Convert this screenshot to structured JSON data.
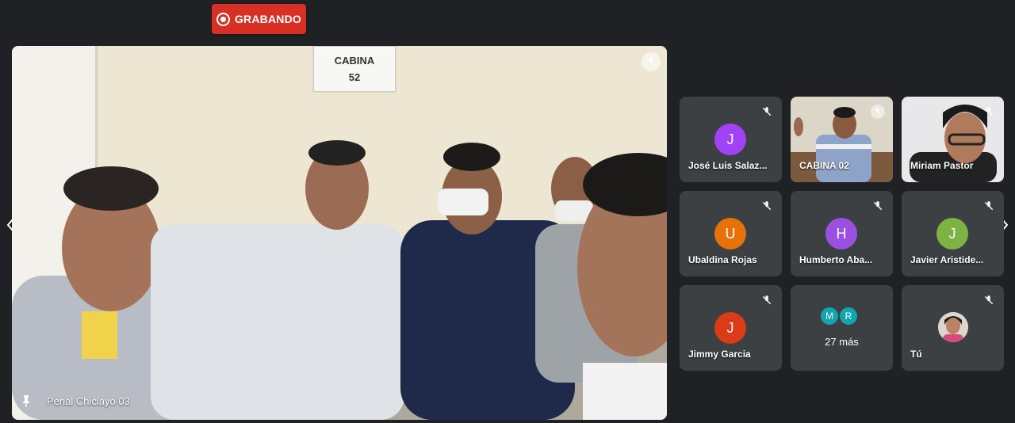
{
  "recording": {
    "label": "GRABANDO",
    "color": "#d93025"
  },
  "main_video": {
    "participant_name": "Penal Chiclayo 03",
    "sign_line1": "CABINA",
    "sign_line2": "52",
    "muted_icon": "mic-off-icon",
    "pin_icon": "pin-icon"
  },
  "navigation": {
    "prev_icon": "chevron-left-icon",
    "next_icon": "chevron-right-icon"
  },
  "participants": [
    {
      "name": "José Luis Salaz...",
      "initial": "J",
      "color": "#a142f4",
      "muted": true
    },
    {
      "name": "CABINA 02",
      "video": true,
      "muted": true
    },
    {
      "name": "Miriam Pastor",
      "video": true,
      "muted": true
    },
    {
      "name": "Ubaldina Rojas",
      "initial": "U",
      "color": "#e8710a",
      "muted": true
    },
    {
      "name": "Humberto Aba...",
      "initial": "H",
      "color": "#9b51e0",
      "muted": true
    },
    {
      "name": "Javier Aristide...",
      "initial": "J",
      "color": "#7cb342",
      "muted": true
    },
    {
      "name": "Jimmy Garcia",
      "initial": "J",
      "color": "#d93c16",
      "muted": true
    },
    {
      "more_initials": [
        "M",
        "R"
      ],
      "more_label": "27 más",
      "color": "#12a4af"
    },
    {
      "name": "Tú",
      "self": true,
      "muted": true
    }
  ]
}
